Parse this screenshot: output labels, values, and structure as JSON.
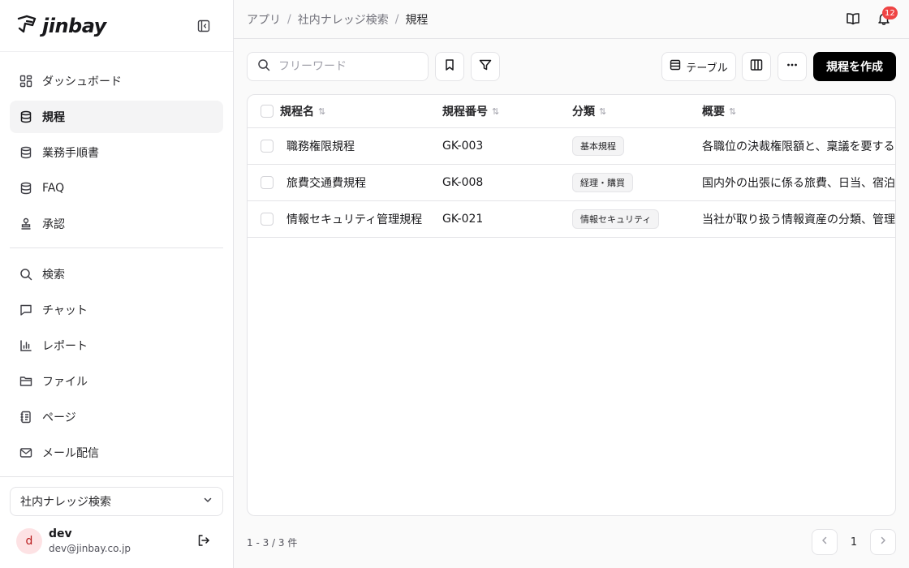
{
  "brand": {
    "name": "jinbay"
  },
  "sidebar": {
    "items": [
      {
        "label": "ダッシュボード",
        "icon": "dashboard-icon"
      },
      {
        "label": "規程",
        "icon": "database-icon",
        "active": true
      },
      {
        "label": "業務手順書",
        "icon": "database-icon"
      },
      {
        "label": "FAQ",
        "icon": "database-icon"
      },
      {
        "label": "承認",
        "icon": "stamp-icon"
      }
    ],
    "tools": [
      {
        "label": "検索",
        "icon": "search-icon"
      },
      {
        "label": "チャット",
        "icon": "chat-icon"
      },
      {
        "label": "レポート",
        "icon": "bar-chart-icon"
      },
      {
        "label": "ファイル",
        "icon": "folder-icon"
      },
      {
        "label": "ページ",
        "icon": "notebook-icon"
      },
      {
        "label": "メール配信",
        "icon": "mail-icon"
      }
    ],
    "workspace": "社内ナレッジ検索",
    "user": {
      "initial": "d",
      "name": "dev",
      "email": "dev@jinbay.co.jp"
    }
  },
  "header": {
    "breadcrumbs": [
      "アプリ",
      "社内ナレッジ検索",
      "規程"
    ],
    "notifications": "12"
  },
  "toolbar": {
    "search_placeholder": "フリーワード",
    "search_value": "",
    "view_label": "テーブル",
    "create_label": "規程を作成"
  },
  "table": {
    "columns": [
      "規程名",
      "規程番号",
      "分類",
      "概要"
    ],
    "rows": [
      {
        "name": "職務権限規程",
        "code": "GK-003",
        "category": "基本規程",
        "summary": "各職位の決裁権限額と、稟議を要する"
      },
      {
        "name": "旅費交通費規程",
        "code": "GK-008",
        "category": "経理・購買",
        "summary": "国内外の出張に係る旅費、日当、宿泊"
      },
      {
        "name": "情報セキュリティ管理規程",
        "code": "GK-021",
        "category": "情報セキュリティ",
        "summary": "当社が取り扱う情報資産の分類、管理"
      }
    ]
  },
  "footer": {
    "count": "1 - 3 / 3 件",
    "page": "1"
  },
  "colors": {
    "accent": "#000000",
    "badge": "#ef4444",
    "active_bg": "#f4f4f5"
  }
}
